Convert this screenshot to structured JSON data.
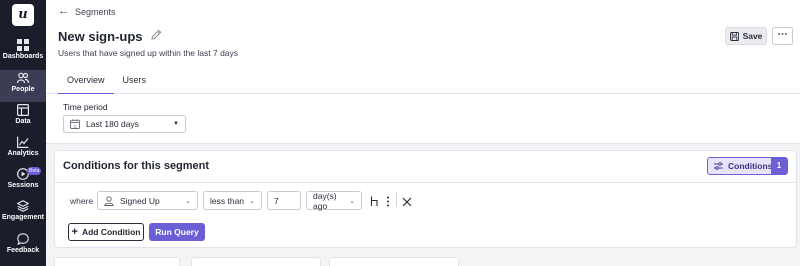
{
  "sidebar": {
    "logo": "u",
    "items": [
      {
        "label": "Dashboards",
        "icon": "grid-icon"
      },
      {
        "label": "People",
        "icon": "people-icon"
      },
      {
        "label": "Data",
        "icon": "data-icon"
      },
      {
        "label": "Analytics",
        "icon": "line-chart-icon"
      },
      {
        "label": "Sessions",
        "icon": "play-icon",
        "badge": "Beta"
      },
      {
        "label": "Engagement",
        "icon": "layers-icon"
      },
      {
        "label": "Feedback",
        "icon": "chat-icon"
      }
    ],
    "active": "People"
  },
  "header": {
    "back_label": "Segments",
    "title": "New sign-ups",
    "subtitle": "Users that have signed up within the last 7 days",
    "save_label": "Save",
    "more_label": "⋯",
    "tabs": [
      {
        "label": "Overview",
        "active": true
      },
      {
        "label": "Users",
        "active": false
      }
    ]
  },
  "time_period": {
    "label": "Time period",
    "value": "Last 180 days"
  },
  "conditions": {
    "title": "Conditions for this segment",
    "button_label": "Conditions",
    "count": "1",
    "row": {
      "where": "where",
      "field": "Signed Up",
      "operator": "less than",
      "value": "7",
      "unit": "day(s) ago"
    },
    "add_label": "Add Condition",
    "run_label": "Run Query"
  },
  "colors": {
    "sidebar_bg": "#1b1d2a",
    "accent": "#6b5fd6",
    "page_bg": "#f4f4f6"
  }
}
